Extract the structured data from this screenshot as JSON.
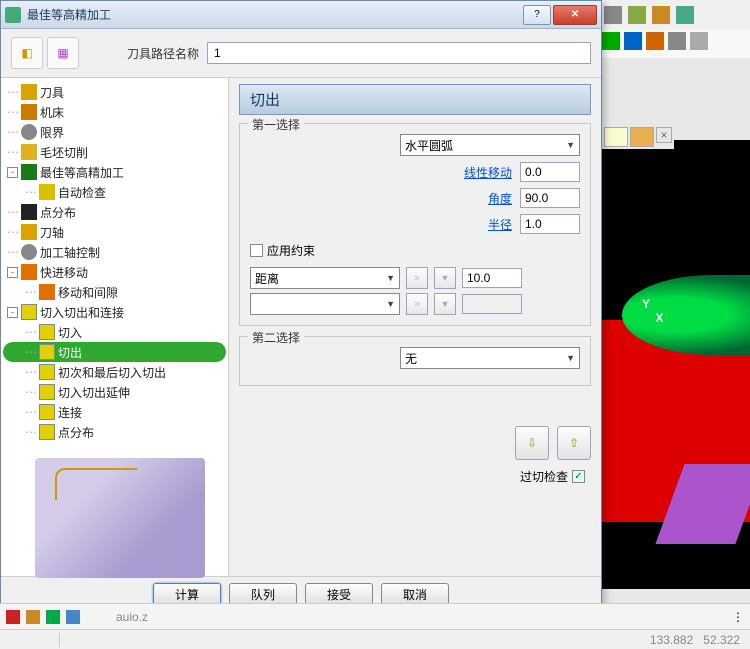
{
  "window": {
    "title": "最佳等高精加工",
    "help_glyph": "?",
    "close_glyph": "✕"
  },
  "toolpath_name": {
    "label": "刀具路径名称",
    "value": "1"
  },
  "tree": [
    {
      "depth": 0,
      "expander": "",
      "icon": "ic-tool",
      "label": "刀具"
    },
    {
      "depth": 0,
      "expander": "",
      "icon": "ic-machine",
      "label": "机床"
    },
    {
      "depth": 0,
      "expander": "",
      "icon": "ic-limit",
      "label": "限界"
    },
    {
      "depth": 0,
      "expander": "",
      "icon": "ic-stock",
      "label": "毛坯切削"
    },
    {
      "depth": 0,
      "expander": "-",
      "icon": "ic-green",
      "label": "最佳等高精加工"
    },
    {
      "depth": 1,
      "expander": "",
      "icon": "ic-check",
      "label": "自动检查"
    },
    {
      "depth": 0,
      "expander": "",
      "icon": "ic-points",
      "label": "点分布"
    },
    {
      "depth": 0,
      "expander": "",
      "icon": "ic-tool",
      "label": "刀轴"
    },
    {
      "depth": 0,
      "expander": "",
      "icon": "ic-limit",
      "label": "加工轴控制"
    },
    {
      "depth": 0,
      "expander": "-",
      "icon": "ic-rapid",
      "label": "快进移动"
    },
    {
      "depth": 1,
      "expander": "",
      "icon": "ic-rapid",
      "label": "移动和间隙"
    },
    {
      "depth": 0,
      "expander": "-",
      "icon": "ic-yellow-u",
      "label": "切入切出和连接"
    },
    {
      "depth": 1,
      "expander": "",
      "icon": "ic-yellow-u",
      "label": "切入"
    },
    {
      "depth": 1,
      "expander": "",
      "icon": "ic-yellow-u",
      "label": "切出",
      "selected": true
    },
    {
      "depth": 1,
      "expander": "",
      "icon": "ic-yellow-u",
      "label": "初次和最后切入切出"
    },
    {
      "depth": 1,
      "expander": "",
      "icon": "ic-yellow-u",
      "label": "切入切出延伸"
    },
    {
      "depth": 1,
      "expander": "",
      "icon": "ic-yellow-u",
      "label": "连接"
    },
    {
      "depth": 1,
      "expander": "",
      "icon": "ic-yellow-u",
      "label": "点分布"
    }
  ],
  "panel": {
    "title": "切出",
    "group1": {
      "label": "第一选择",
      "type": "水平圆弧",
      "linear_label": "线性移动",
      "linear_value": "0.0",
      "angle_label": "角度",
      "angle_value": "90.0",
      "radius_label": "半径",
      "radius_value": "1.0",
      "apply_constraint_label": "应用约束",
      "constraint_type": "距离",
      "constraint_gt": ">",
      "constraint_value": "10.0"
    },
    "group2": {
      "label": "第二选择",
      "type": "无"
    },
    "overcut_check_label": "过切检查"
  },
  "footer": {
    "calculate": "计算",
    "queue": "队列",
    "accept": "接受",
    "cancel": "取消"
  },
  "viewport": {
    "axis_y": "Y",
    "axis_x": "X"
  },
  "bottom": {
    "coord_label": "auio.z",
    "val1": "133.882",
    "val2": "52.322"
  }
}
